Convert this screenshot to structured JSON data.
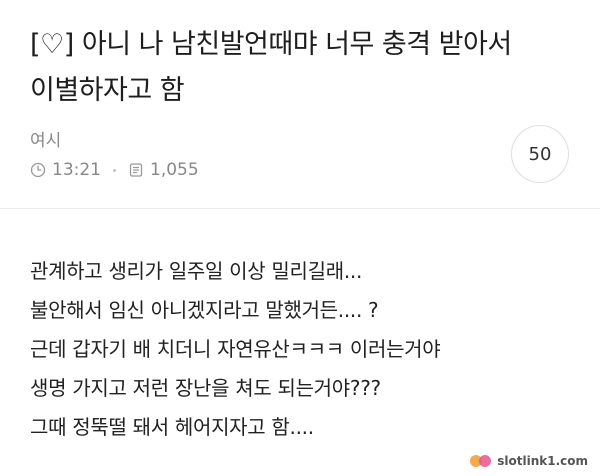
{
  "post": {
    "title": "[♡] 아니 나 남친발언때먀 너무 충격 받아서 이별하자고 함",
    "author": "여시",
    "time": "13:21",
    "views": "1,055",
    "comment_count": "50",
    "body_lines": [
      "관계하고 생리가 일주일 이상 밀리길래...",
      "불안해서 임신 아니겠지라고 말했거든.... ?",
      "근데 갑자기 배 치더니 자연유산ㅋㅋㅋ 이러는거야",
      "생명 가지고 저런 장난을 쳐도 되는거야???",
      "그때 정뚝떨 돼서 헤어지자고 함...."
    ]
  },
  "watermark": {
    "text": "slotlink1.com"
  },
  "colors": {
    "text": "#222222",
    "meta": "#888888",
    "divider": "#ececec",
    "watermark_orange": "#f0a23c",
    "watermark_pink": "#e8558a"
  },
  "icons": {
    "time": "clock-icon",
    "views": "document-icon",
    "watermark": "logo-icon"
  }
}
